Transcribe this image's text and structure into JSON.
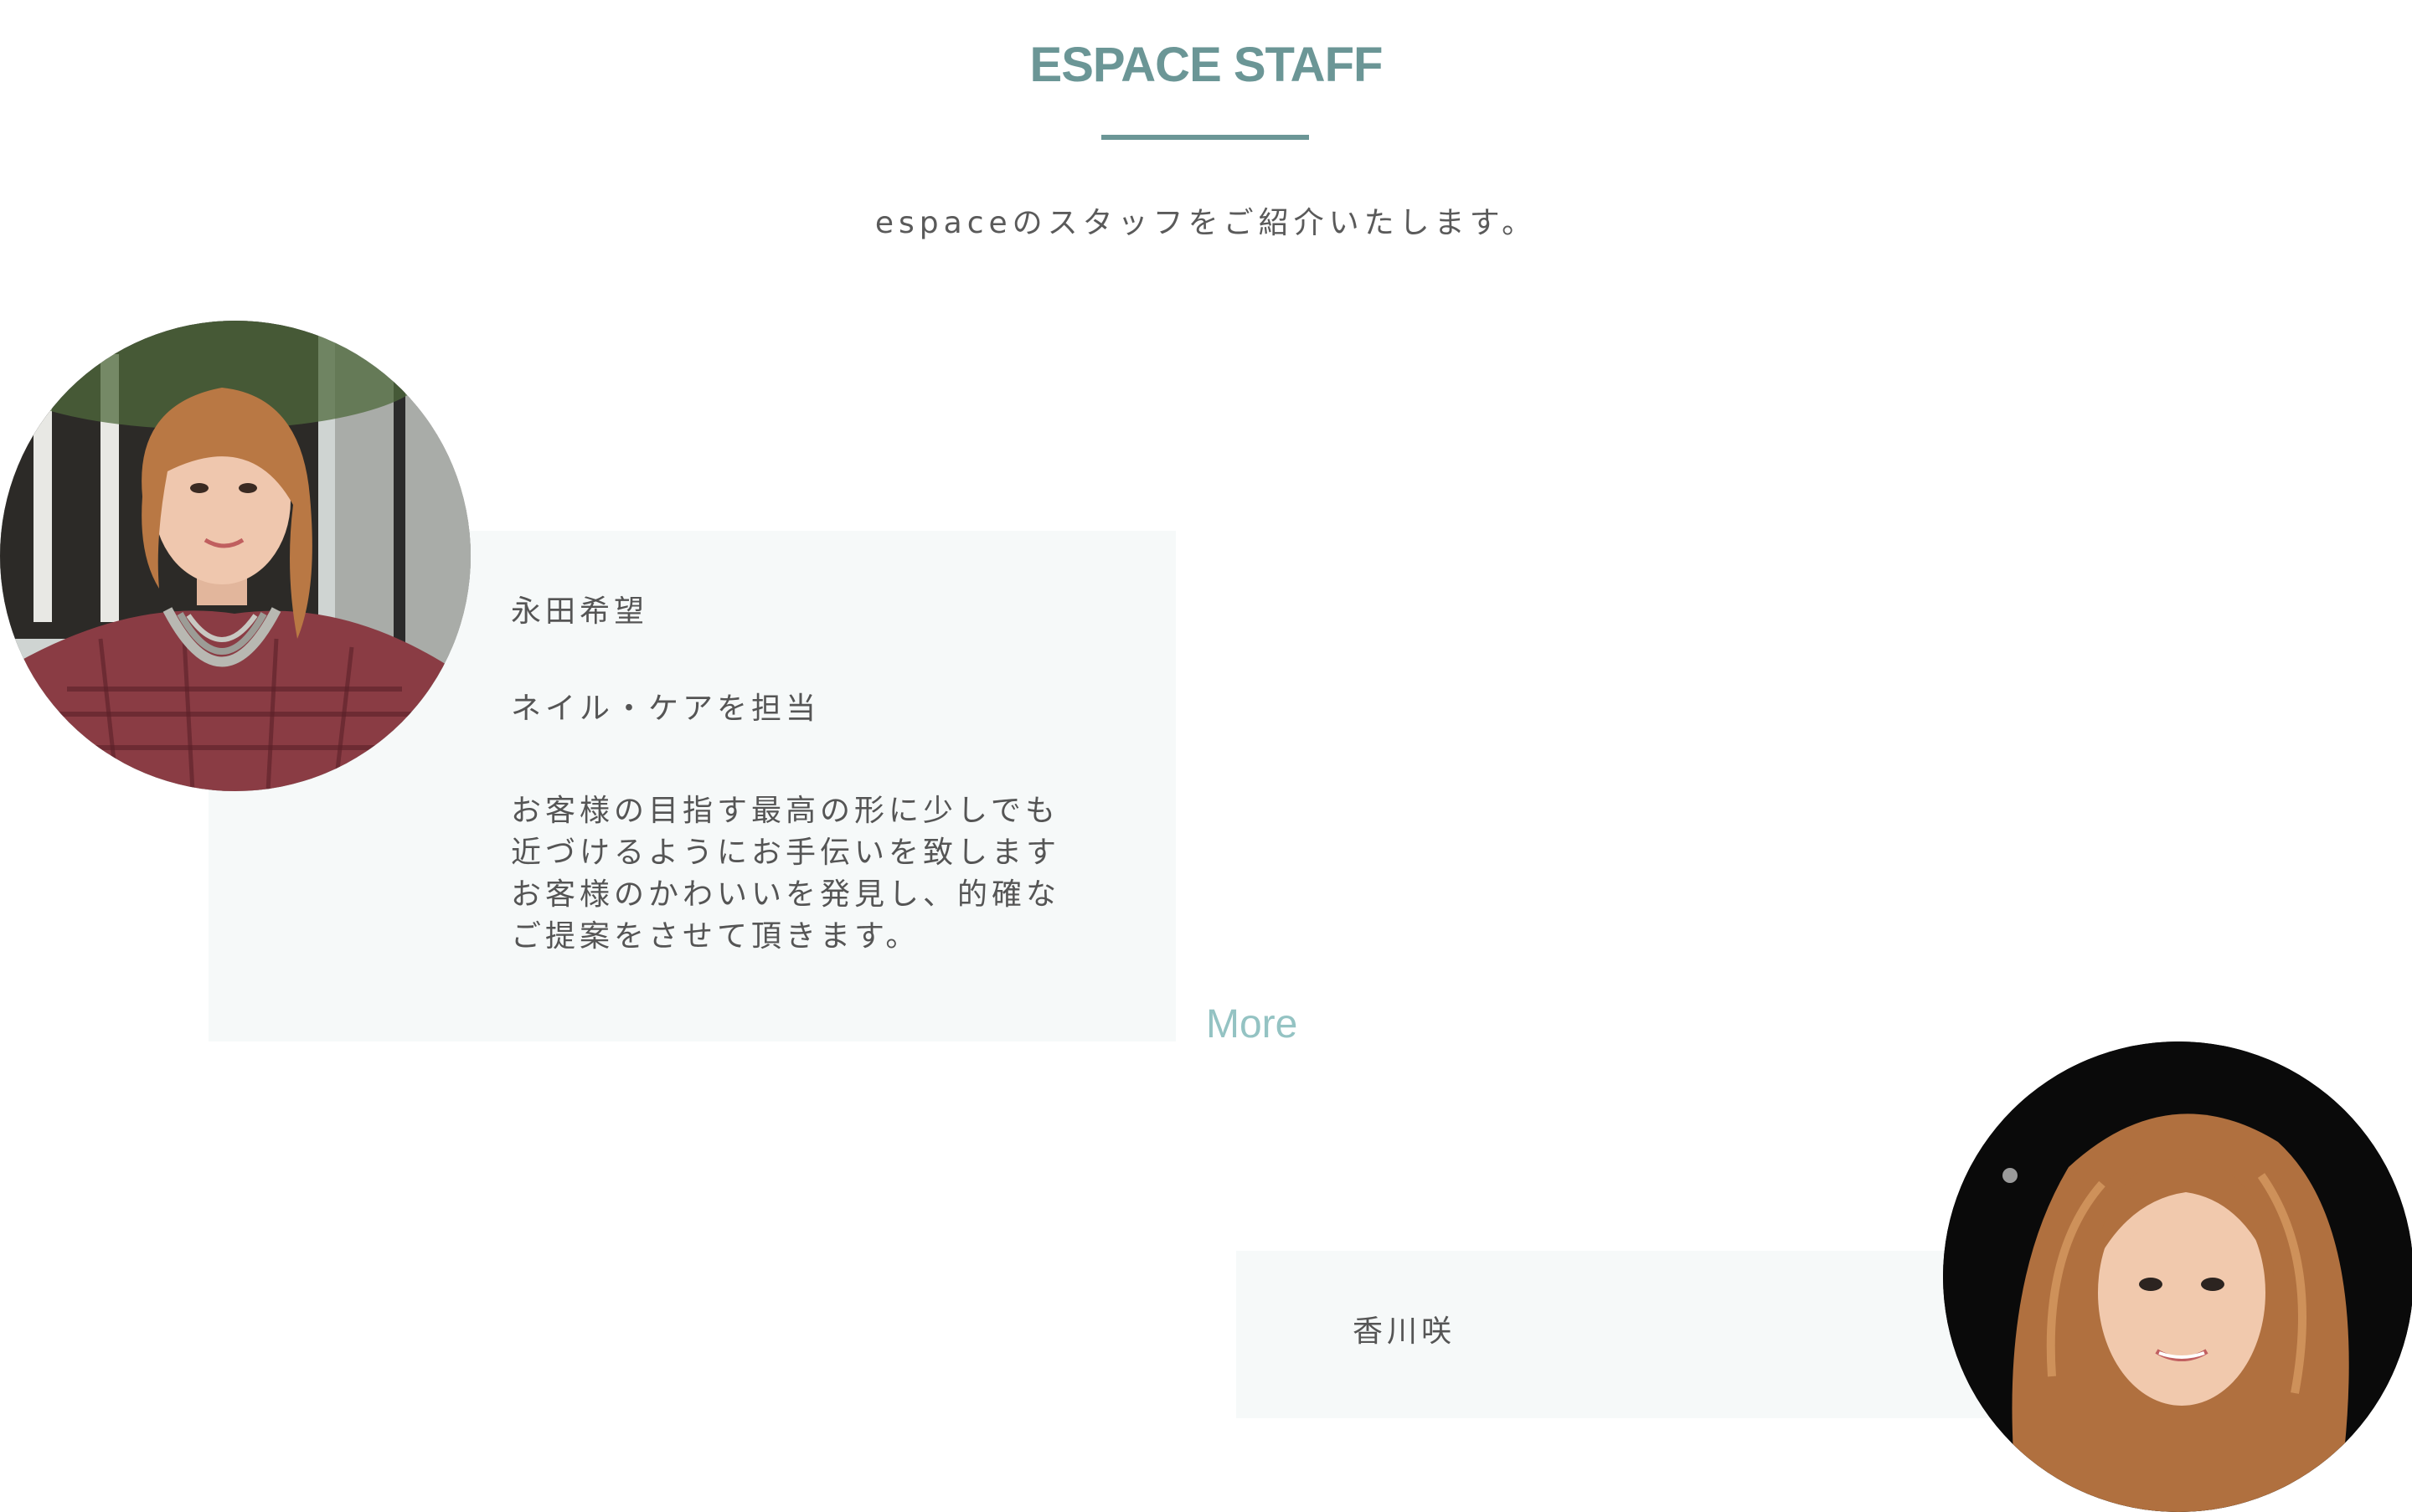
{
  "section": {
    "title": "ESPACE STAFF",
    "intro": "espaceのスタッフをご紹介いたします。"
  },
  "staff": [
    {
      "name": "永田希望",
      "role": "ネイル・ケアを担当",
      "description": [
        "お客様の目指す最高の形に少しでも",
        "近づけるようにお手伝いを致します",
        "お客様のかわいいを発見し、的確な",
        "ご提案をさせて頂きます。"
      ],
      "more_label": "More"
    },
    {
      "name": "香川咲"
    }
  ],
  "colors": {
    "accent": "#6b9696",
    "link": "#94c3c3",
    "card_background": "#f6f9f9",
    "text": "#555555"
  }
}
